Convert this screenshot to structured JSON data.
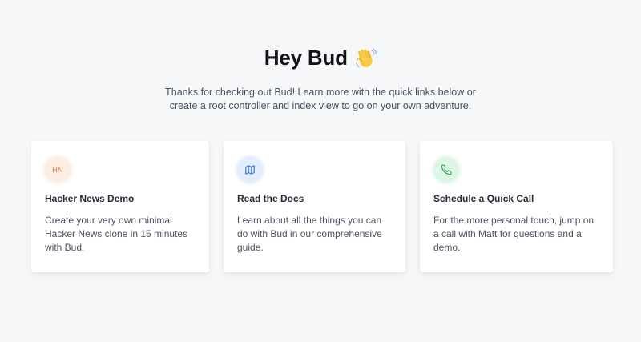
{
  "header": {
    "title": "Hey Bud",
    "emoji_icon": "waving-hand-icon",
    "intro_line1": "Thanks for checking out Bud! Learn more with the quick links below or",
    "intro_line2": "create a root controller and index view to go on your own adventure."
  },
  "cards": [
    {
      "icon_text": "HN",
      "icon": "hacker-news-icon",
      "title": "Hacker News Demo",
      "description": "Create your very own minimal Hacker News clone in 15 minutes with Bud."
    },
    {
      "icon": "map-icon",
      "title": "Read the Docs",
      "description": "Learn about all the things you can do with Bud in our comprehensive guide."
    },
    {
      "icon": "phone-icon",
      "title": "Schedule a Quick Call",
      "description": "For the more personal touch, jump on a call with Matt for questions and a demo."
    }
  ],
  "colors": {
    "background": "#f6f7f9",
    "hn_accent": "#d9824a",
    "docs_accent": "#3b7be0",
    "call_accent": "#2f9e55"
  }
}
